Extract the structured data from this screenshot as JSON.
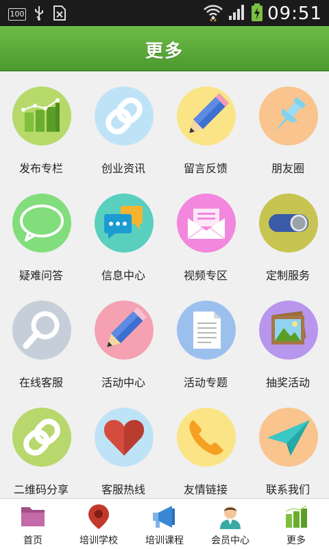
{
  "status_bar": {
    "battery_text": "100",
    "time": "09:51",
    "icons": [
      "battery-100-icon",
      "usb-icon",
      "sim-card-icon",
      "wifi-icon",
      "signal-icon",
      "battery-charging-icon"
    ]
  },
  "header": {
    "title": "更多"
  },
  "grid": {
    "items": [
      {
        "label": "发布专栏",
        "icon": "chart-bars-icon",
        "color": "#b6d96a"
      },
      {
        "label": "创业资讯",
        "icon": "link-icon",
        "color": "#bfe3f6"
      },
      {
        "label": "留言反馈",
        "icon": "pencil-icon",
        "color": "#fbe486"
      },
      {
        "label": "朋友圈",
        "icon": "pushpin-icon",
        "color": "#f9c48e"
      },
      {
        "label": "疑难问答",
        "icon": "speech-bubble-icon",
        "color": "#82dd7c"
      },
      {
        "label": "信息中心",
        "icon": "chat-bubbles-icon",
        "color": "#59cfbe"
      },
      {
        "label": "视频专区",
        "icon": "envelope-icon",
        "color": "#f287dd"
      },
      {
        "label": "定制服务",
        "icon": "toggle-icon",
        "color": "#c7c451"
      },
      {
        "label": "在线客服",
        "icon": "magnifier-icon",
        "color": "#c6cfd9"
      },
      {
        "label": "活动中心",
        "icon": "pencil-icon",
        "color": "#f5a1b2"
      },
      {
        "label": "活动专题",
        "icon": "document-icon",
        "color": "#9cc0ee"
      },
      {
        "label": "抽奖活动",
        "icon": "picture-icon",
        "color": "#b896ee"
      },
      {
        "label": "二维码分享",
        "icon": "link-icon",
        "color": "#b8d76c"
      },
      {
        "label": "客服热线",
        "icon": "heart-icon",
        "color": "#bfe3f6"
      },
      {
        "label": "友情链接",
        "icon": "phone-icon",
        "color": "#fbe486"
      },
      {
        "label": "联系我们",
        "icon": "paper-plane-icon",
        "color": "#f9c48e"
      }
    ]
  },
  "tabbar": {
    "items": [
      {
        "label": "首页",
        "icon": "folder-icon"
      },
      {
        "label": "培训学校",
        "icon": "map-pin-icon"
      },
      {
        "label": "培训课程",
        "icon": "megaphone-icon"
      },
      {
        "label": "会员中心",
        "icon": "user-icon"
      },
      {
        "label": "更多",
        "icon": "chart-bars-icon"
      }
    ]
  }
}
